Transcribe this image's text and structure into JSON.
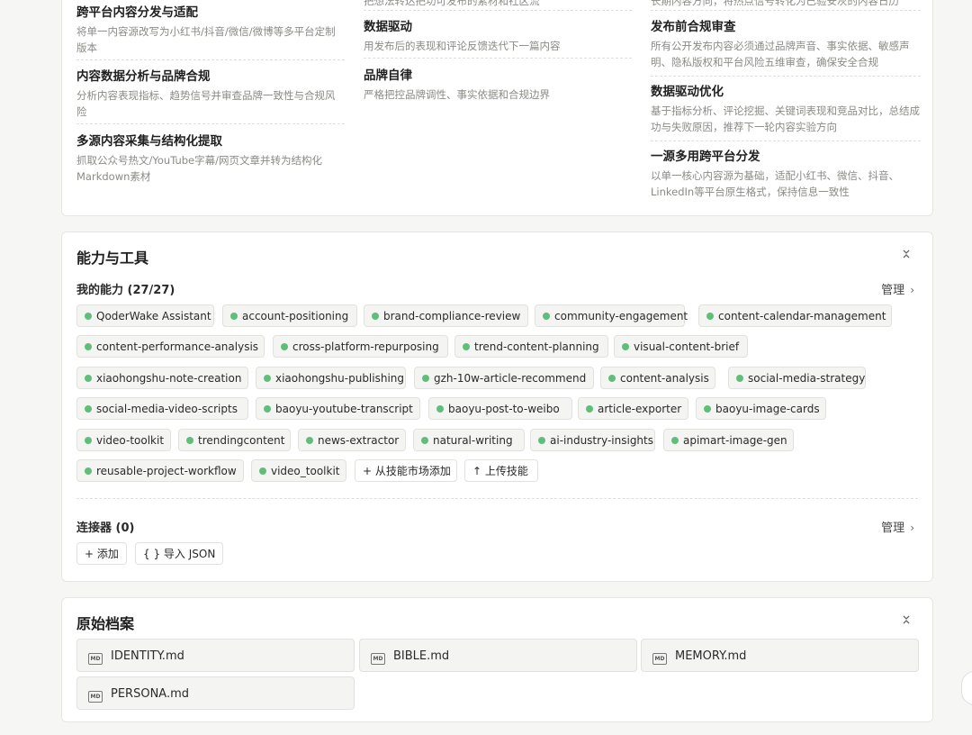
{
  "principles": {
    "col1": [
      {
        "title": "跨平台内容分发与适配",
        "desc": "将单一内容源改写为小红书/抖音/微信/微博等多平台定制版本"
      },
      {
        "title": "内容数据分析与品牌合规",
        "desc": "分析内容表现指标、趋势信号并审查品牌一致性与合规风险"
      },
      {
        "title": "多源内容采集与结构化提取",
        "desc": "抓取公众号热文/YouTube字幕/网页文章并转为结构化Markdown素材"
      }
    ],
    "col2_clipped": "把想法转达把功可发布的素材和社区流",
    "col2": [
      {
        "title": "数据驱动",
        "desc": "用发布后的表现和评论反馈迭代下一篇内容"
      },
      {
        "title": "品牌自律",
        "desc": "严格把控品牌调性、事实依据和合规边界"
      }
    ],
    "col3_clipped": "长期内容方向，将热点信号转化为已验安灰的内容日历",
    "col3": [
      {
        "title": "发布前合规审查",
        "desc": "所有公开发布内容必须通过品牌声音、事实依据、敏感声明、隐私版权和平台风险五维审查，确保安全合规"
      },
      {
        "title": "数据驱动优化",
        "desc": "基于指标分析、评论挖掘、关键词表现和竞品对比，总结成功与失败原因，推荐下一轮内容实验方向"
      },
      {
        "title": "一源多用跨平台分发",
        "desc": "以单一核心内容源为基础，适配小红书、微信、抖音、LinkedIn等平台原生格式，保持信息一致性"
      }
    ]
  },
  "skills": {
    "title": "能力与工具",
    "my_abilities_label": "我的能力 (27/27)",
    "manage_label": "管理",
    "chips": [
      "QoderWake Assistant",
      "account-positioning",
      "brand-compliance-review",
      "community-engagement",
      "content-calendar-management",
      "content-performance-analysis",
      "cross-platform-repurposing",
      "trend-content-planning",
      "visual-content-brief",
      "xiaohongshu-note-creation",
      "xiaohongshu-publishing",
      "gzh-10w-article-recommend",
      "content-analysis",
      "social-media-strategy",
      "social-media-video-scripts",
      "baoyu-youtube-transcript",
      "baoyu-post-to-weibo",
      "article-exporter",
      "baoyu-image-cards",
      "video-toolkit",
      "trendingcontent",
      "news-extractor",
      "natural-writing",
      "ai-industry-insights",
      "apimart-image-gen",
      "reusable-project-workflow",
      "video_toolkit"
    ],
    "add_from_market": "+ 从技能市场添加",
    "upload_skill": "↑ 上传技能",
    "connectors_label": "连接器 (0)",
    "connectors_manage": "管理",
    "add_label": "+ 添加",
    "import_json": "{ } 导入 JSON"
  },
  "archive": {
    "title": "原始档案",
    "files": [
      "IDENTITY.md",
      "BIBLE.md",
      "MEMORY.md",
      "PERSONA.md"
    ],
    "file_icon_label": "MD"
  }
}
